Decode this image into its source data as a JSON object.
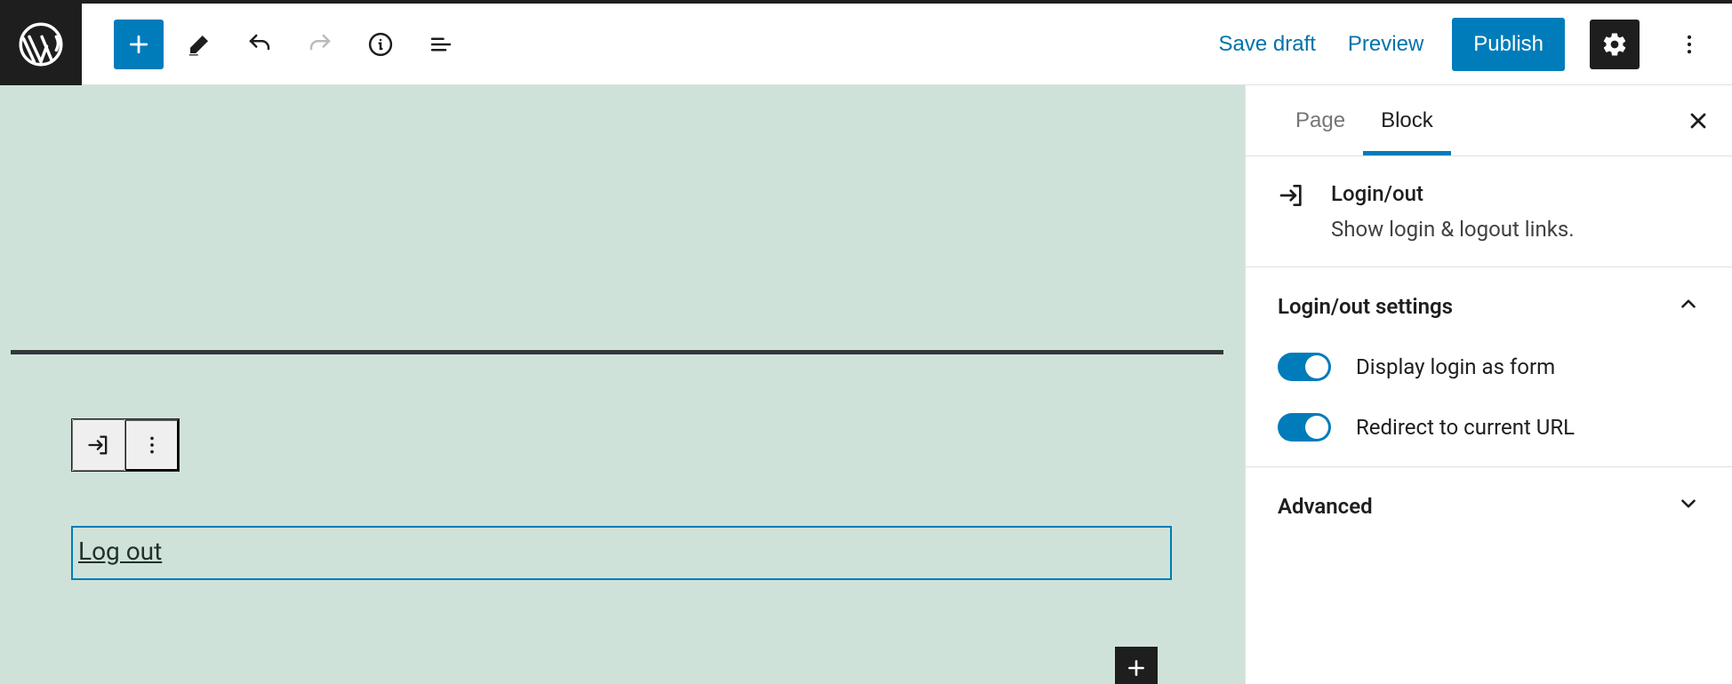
{
  "topbar": {
    "save_draft": "Save draft",
    "preview": "Preview",
    "publish": "Publish"
  },
  "canvas": {
    "block_link_text": "Log out"
  },
  "sidebar": {
    "tabs": {
      "page": "Page",
      "block": "Block"
    },
    "block": {
      "title": "Login/out",
      "description": "Show login & logout links."
    },
    "settings_panel": {
      "title": "Login/out settings",
      "toggles": {
        "display_as_form": "Display login as form",
        "redirect": "Redirect to current URL"
      }
    },
    "advanced_panel": {
      "title": "Advanced"
    }
  }
}
